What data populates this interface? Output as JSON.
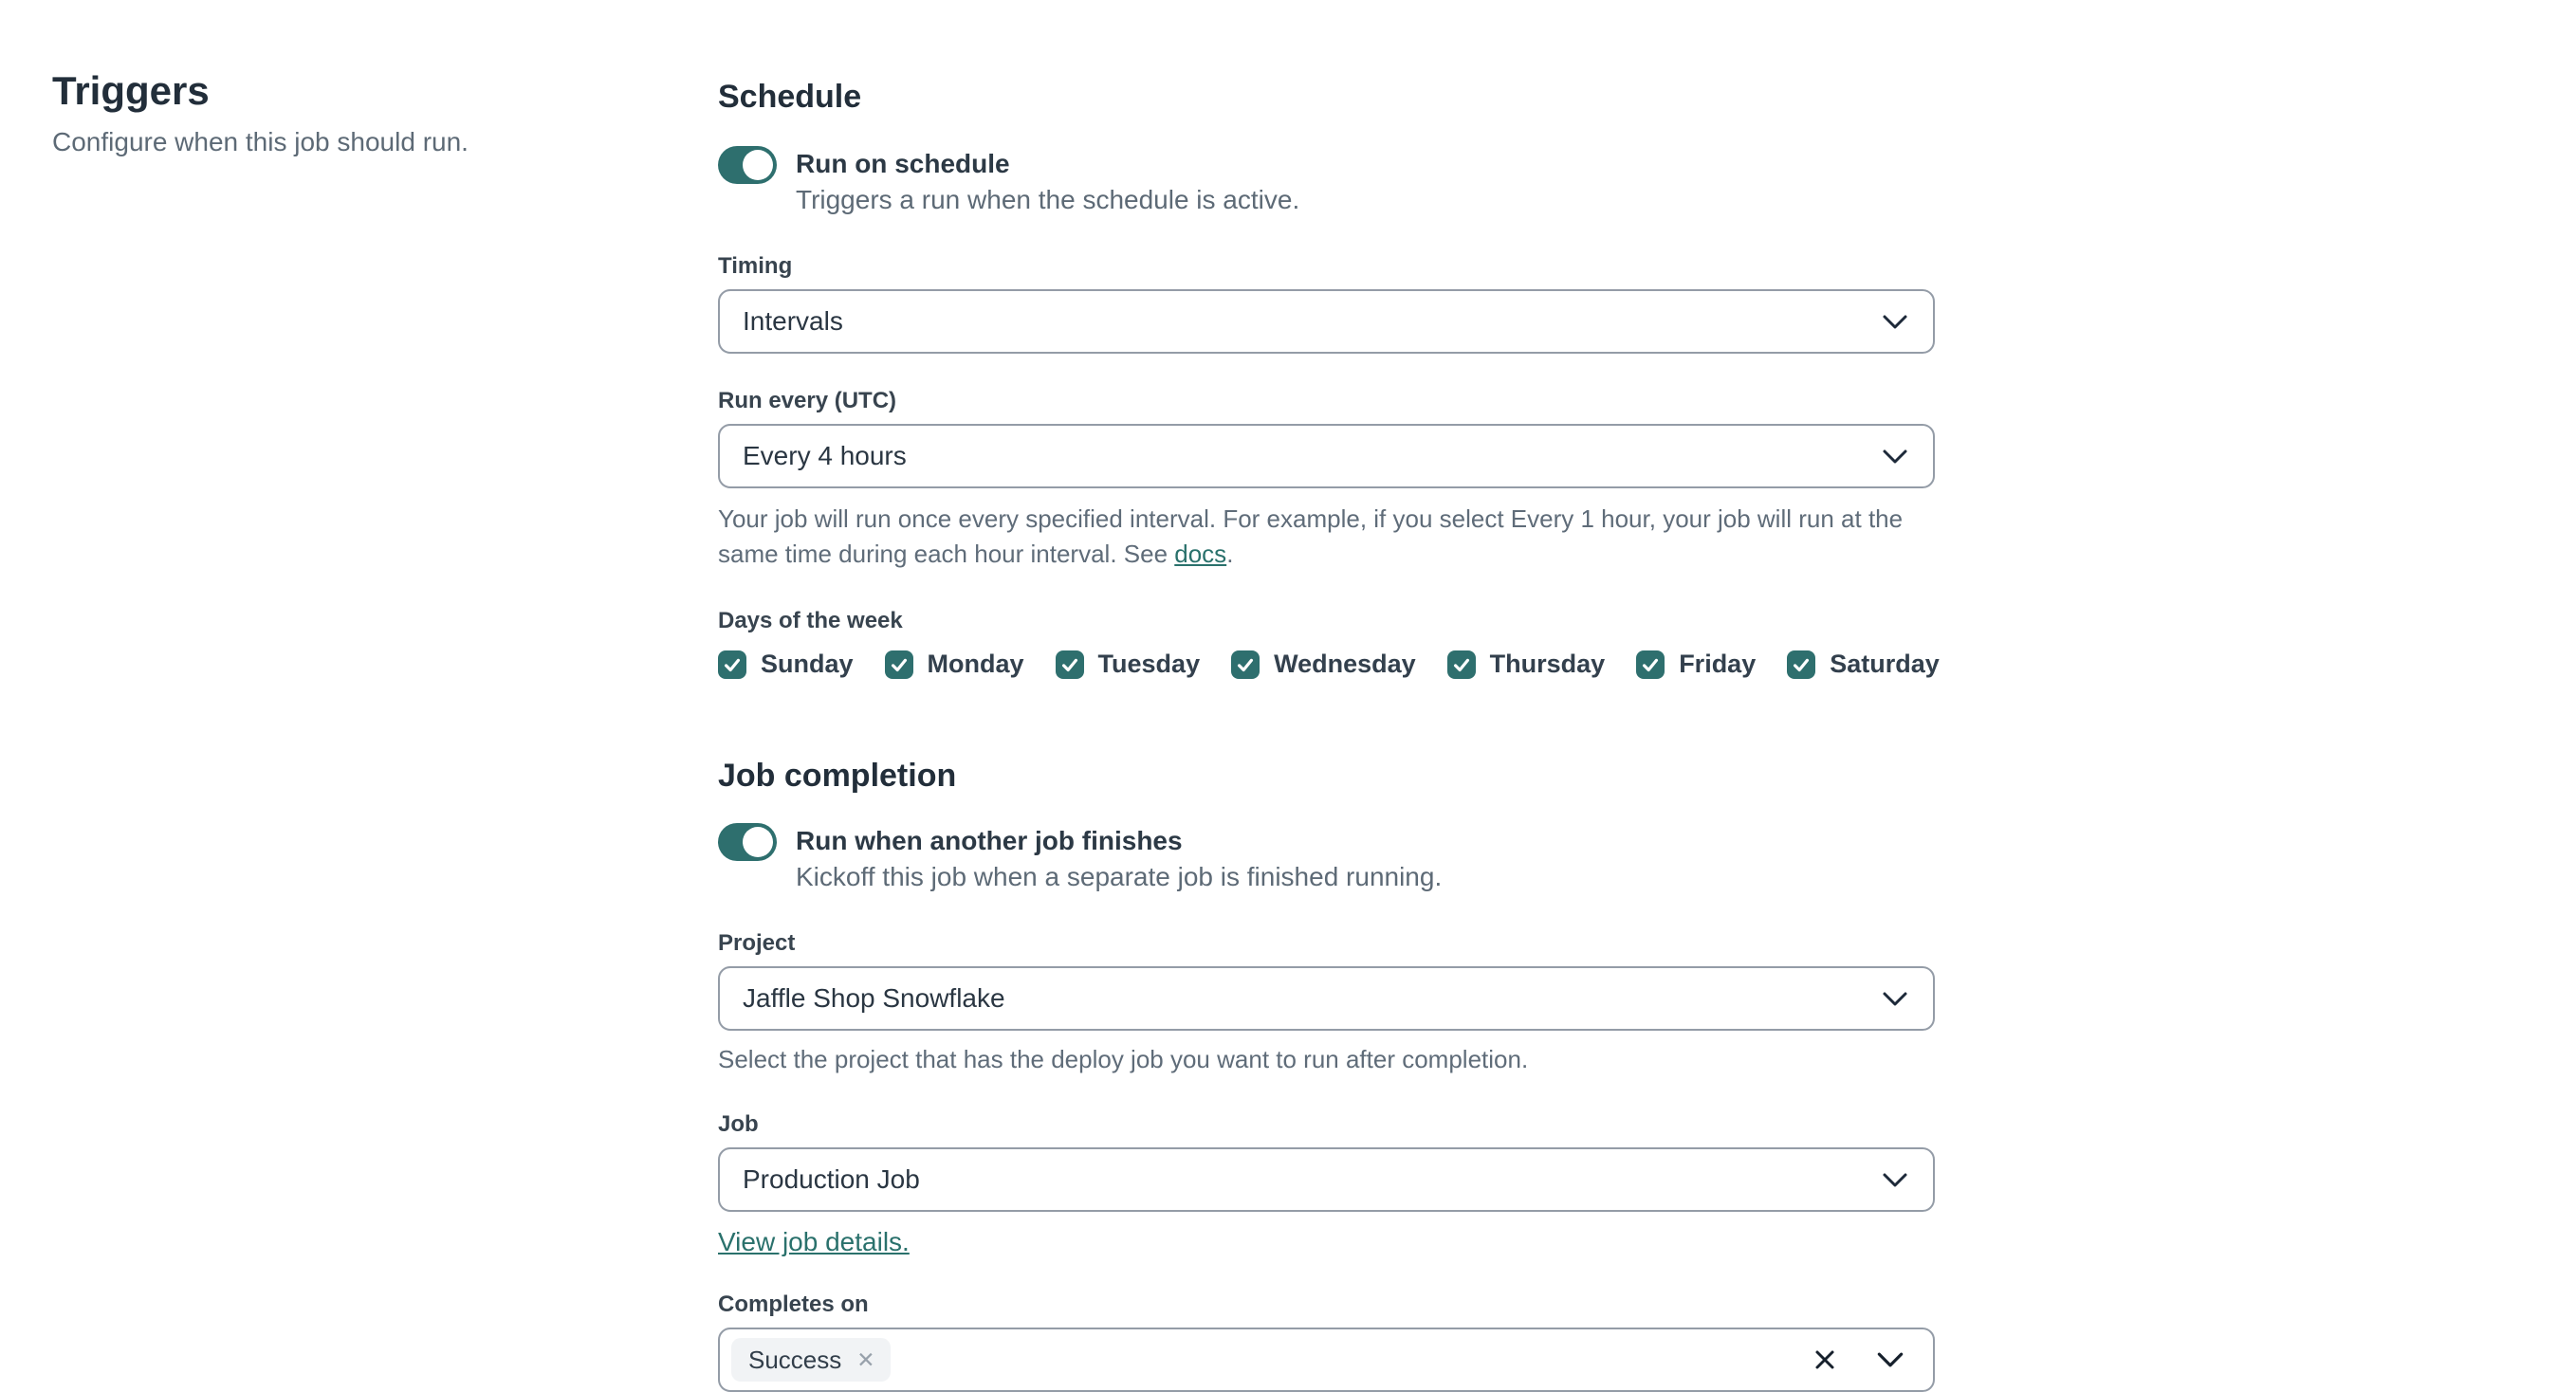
{
  "left": {
    "title": "Triggers",
    "subtitle": "Configure when this job should run."
  },
  "schedule": {
    "heading": "Schedule",
    "toggle": {
      "label": "Run on schedule",
      "description": "Triggers a run when the schedule is active.",
      "on": true
    },
    "timing": {
      "label": "Timing",
      "value": "Intervals"
    },
    "run_every": {
      "label": "Run every (UTC)",
      "value": "Every 4 hours",
      "help_prefix": "Your job will run once every specified interval. For example, if you select Every 1 hour, your job will run at the same time during each hour interval. See ",
      "help_link": "docs",
      "help_suffix": "."
    },
    "days": {
      "label": "Days of the week",
      "items": [
        {
          "label": "Sunday",
          "checked": true
        },
        {
          "label": "Monday",
          "checked": true
        },
        {
          "label": "Tuesday",
          "checked": true
        },
        {
          "label": "Wednesday",
          "checked": true
        },
        {
          "label": "Thursday",
          "checked": true
        },
        {
          "label": "Friday",
          "checked": true
        },
        {
          "label": "Saturday",
          "checked": true
        }
      ]
    }
  },
  "job_completion": {
    "heading": "Job completion",
    "toggle": {
      "label": "Run when another job finishes",
      "description": "Kickoff this job when a separate job is finished running.",
      "on": true
    },
    "project": {
      "label": "Project",
      "value": "Jaffle Shop Snowflake",
      "help": "Select the project that has the deploy job you want to run after completion."
    },
    "job": {
      "label": "Job",
      "value": "Production Job",
      "link": "View job details."
    },
    "completes_on": {
      "label": "Completes on",
      "tags": [
        {
          "label": "Success"
        }
      ]
    }
  },
  "colors": {
    "accent_teal": "#2e6f6e",
    "link_teal": "#2a716c",
    "heading_dark": "#222e3a",
    "secondary_gray": "#5f6c79",
    "border_gray": "#949ca7",
    "tag_bg": "#f1f3f5"
  }
}
